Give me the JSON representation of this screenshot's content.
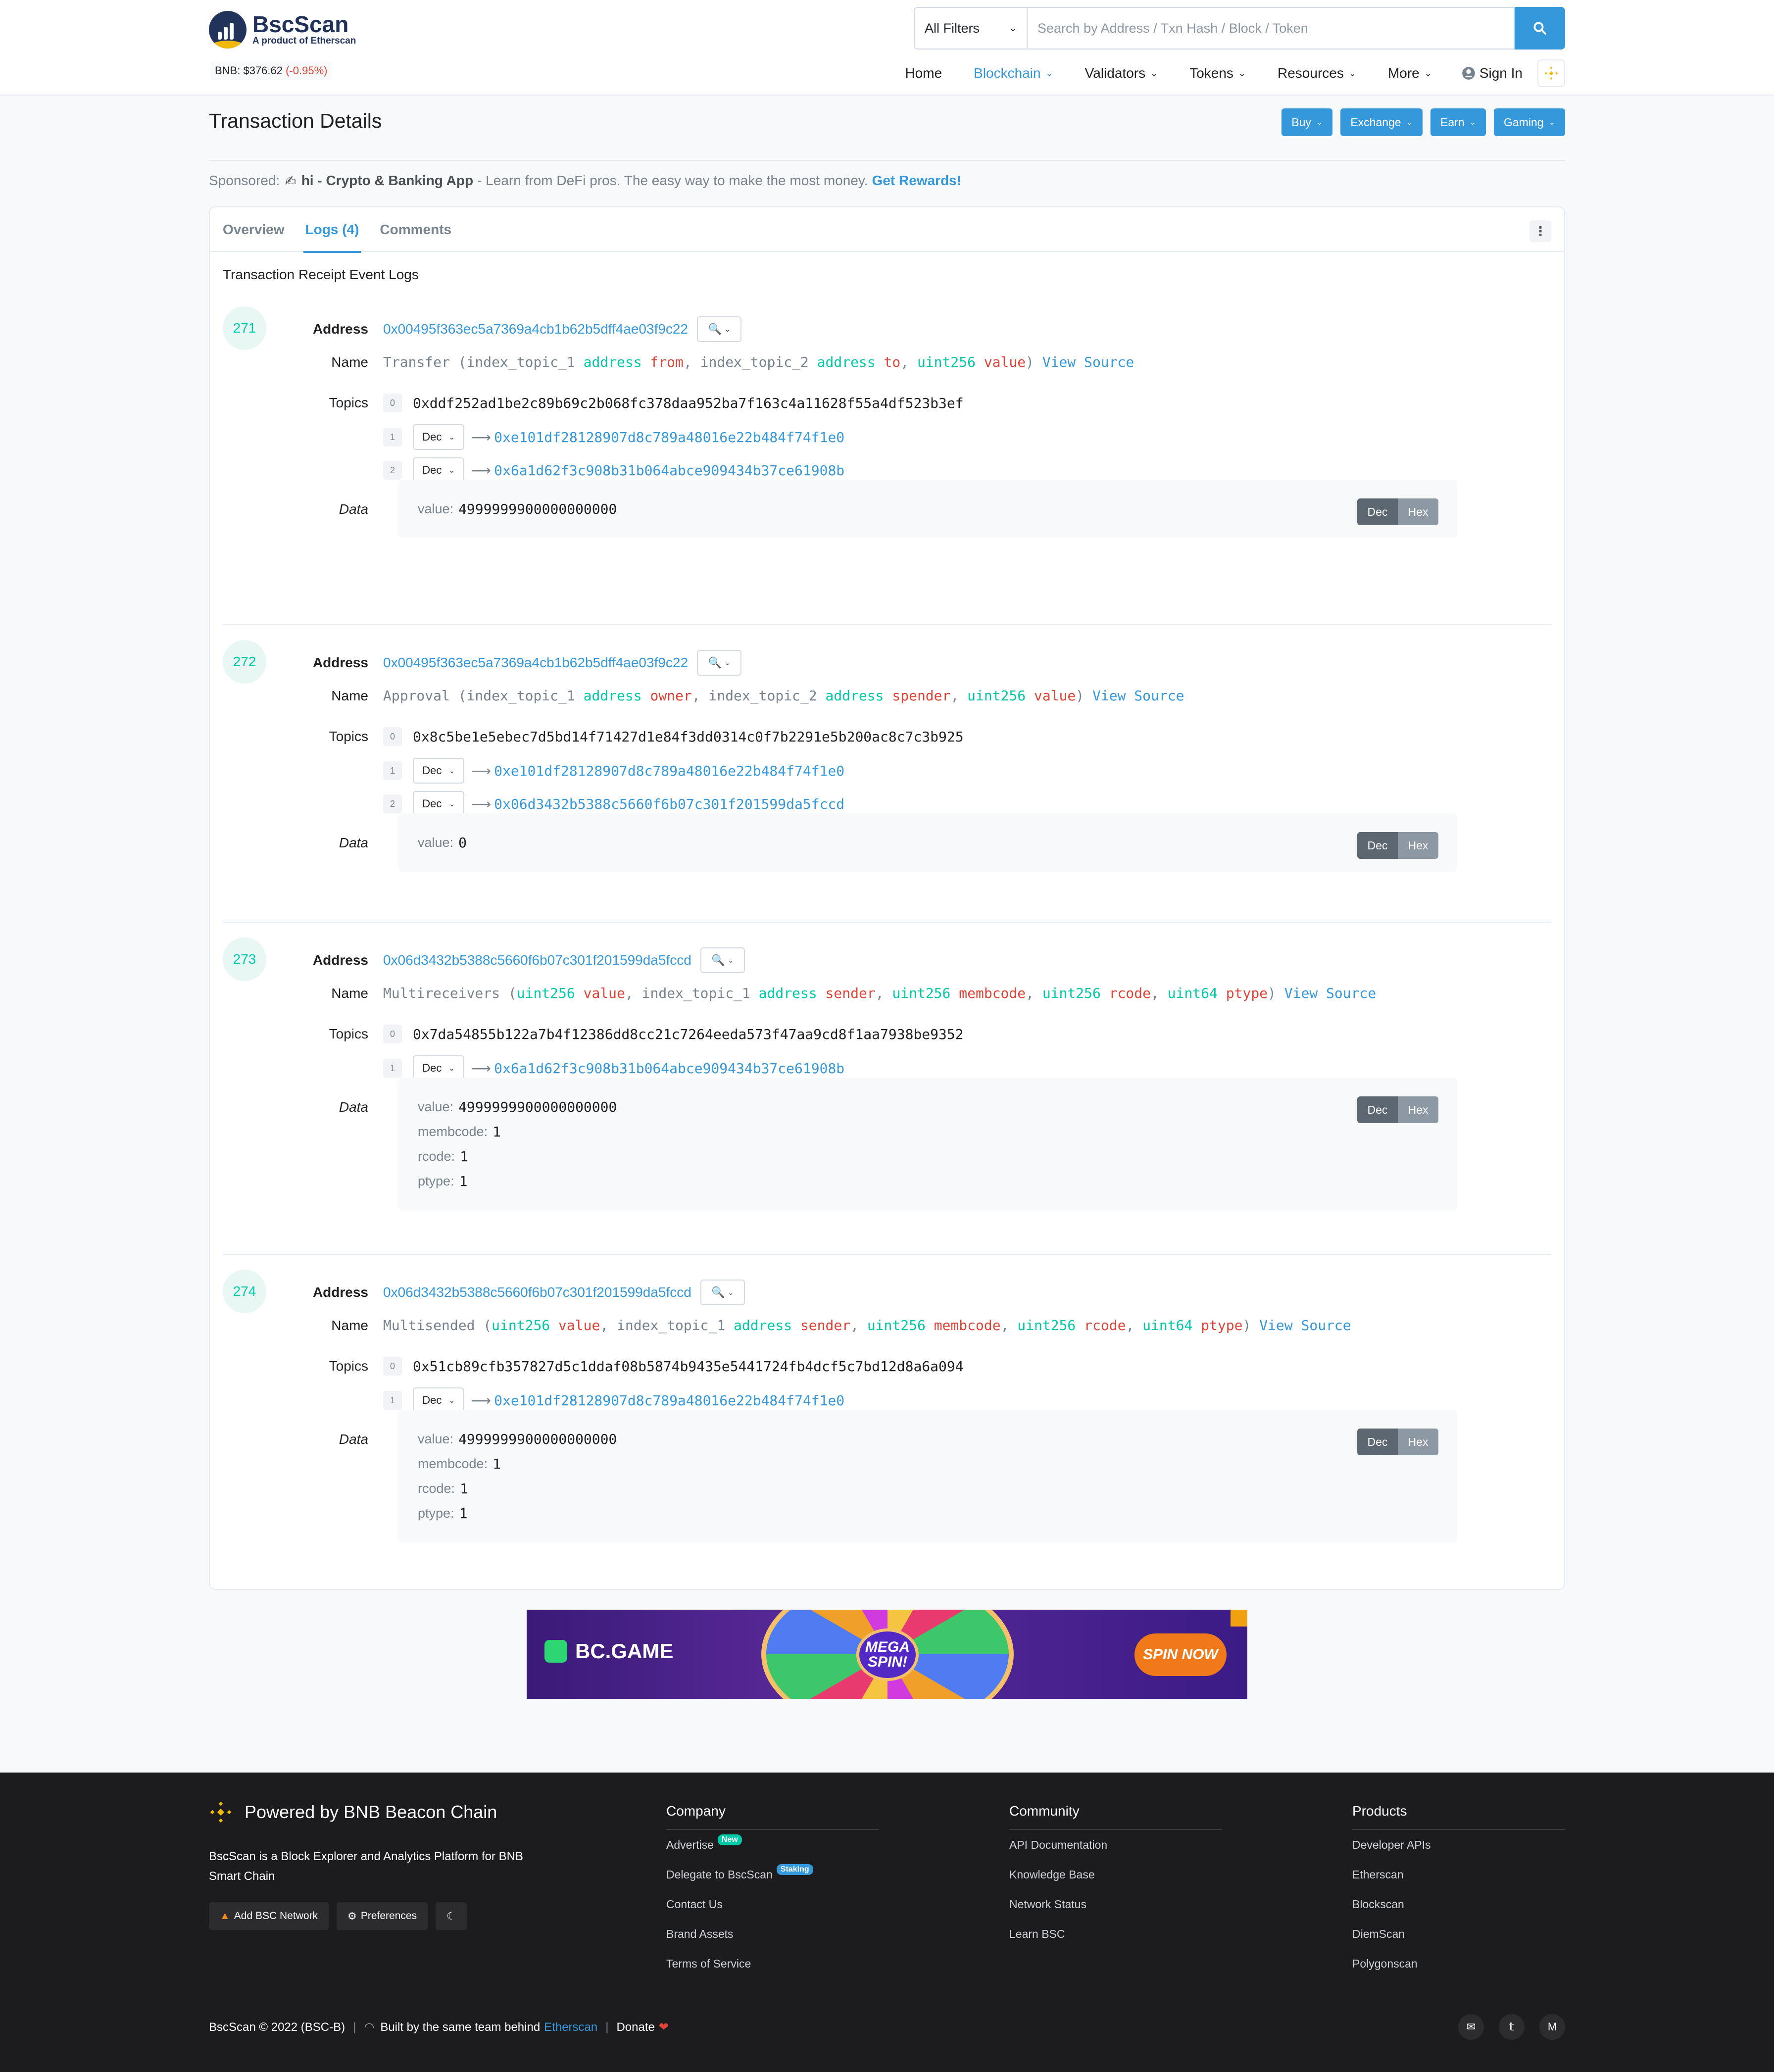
{
  "header": {
    "logo_name": "BscScan",
    "logo_sub": "A product of Etherscan",
    "price_label": "BNB: $376.62",
    "price_change": "(-0.95%)",
    "filter_label": "All Filters",
    "search_placeholder": "Search by Address / Txn Hash / Block / Token",
    "nav": [
      "Home",
      "Blockchain",
      "Validators",
      "Tokens",
      "Resources",
      "More"
    ],
    "sign_in": "Sign In"
  },
  "title": "Transaction Details",
  "pills": [
    "Buy",
    "Exchange",
    "Earn",
    "Gaming"
  ],
  "sponsored": {
    "label": "Sponsored:",
    "name": "hi - Crypto & Banking App",
    "text": "- Learn from DeFi pros. The easy way to make the most money.",
    "cta": "Get Rewards!"
  },
  "tabs": [
    "Overview",
    "Logs (4)",
    "Comments"
  ],
  "card_subtitle": "Transaction Receipt Event Logs",
  "labels": {
    "address": "Address",
    "name": "Name",
    "topics": "Topics",
    "data": "Data",
    "view_source": "View Source",
    "dec": "Dec",
    "hex": "Hex"
  },
  "logs": [
    {
      "index": "271",
      "address": "0x00495f363ec5a7369a4cb1b62b5dff4ae03f9c22",
      "event": "Transfer",
      "params": [
        {
          "pre": "index_topic_1",
          "type": "address",
          "name": "from"
        },
        {
          "pre": "index_topic_2",
          "type": "address",
          "name": "to"
        },
        {
          "pre": "",
          "type": "uint256",
          "name": "value"
        }
      ],
      "topic0": "0xddf252ad1be2c89b69c2b068fc378daa952ba7f163c4a11628f55a4df523b3ef",
      "topics": [
        "0xe101df28128907d8c789a48016e22b484f74f1e0",
        "0x6a1d62f3c908b31b064abce909434b37ce61908b"
      ],
      "data": [
        {
          "k": "value",
          "v": "4999999900000000000"
        }
      ]
    },
    {
      "index": "272",
      "address": "0x00495f363ec5a7369a4cb1b62b5dff4ae03f9c22",
      "event": "Approval",
      "params": [
        {
          "pre": "index_topic_1",
          "type": "address",
          "name": "owner"
        },
        {
          "pre": "index_topic_2",
          "type": "address",
          "name": "spender"
        },
        {
          "pre": "",
          "type": "uint256",
          "name": "value"
        }
      ],
      "topic0": "0x8c5be1e5ebec7d5bd14f71427d1e84f3dd0314c0f7b2291e5b200ac8c7c3b925",
      "topics": [
        "0xe101df28128907d8c789a48016e22b484f74f1e0",
        "0x06d3432b5388c5660f6b07c301f201599da5fccd"
      ],
      "data": [
        {
          "k": "value",
          "v": "0"
        }
      ]
    },
    {
      "index": "273",
      "address": "0x06d3432b5388c5660f6b07c301f201599da5fccd",
      "event": "Multireceivers",
      "params": [
        {
          "pre": "",
          "type": "uint256",
          "name": "value"
        },
        {
          "pre": "index_topic_1",
          "type": "address",
          "name": "sender"
        },
        {
          "pre": "",
          "type": "uint256",
          "name": "membcode"
        },
        {
          "pre": "",
          "type": "uint256",
          "name": "rcode"
        },
        {
          "pre": "",
          "type": "uint64",
          "name": "ptype"
        }
      ],
      "topic0": "0x7da54855b122a7b4f12386dd8cc21c7264eeda573f47aa9cd8f1aa7938be9352",
      "topics": [
        "0x6a1d62f3c908b31b064abce909434b37ce61908b"
      ],
      "data": [
        {
          "k": "value",
          "v": "4999999900000000000"
        },
        {
          "k": "membcode",
          "v": "1"
        },
        {
          "k": "rcode",
          "v": "1"
        },
        {
          "k": "ptype",
          "v": "1"
        }
      ]
    },
    {
      "index": "274",
      "address": "0x06d3432b5388c5660f6b07c301f201599da5fccd",
      "event": "Multisended",
      "params": [
        {
          "pre": "",
          "type": "uint256",
          "name": "value"
        },
        {
          "pre": "index_topic_1",
          "type": "address",
          "name": "sender"
        },
        {
          "pre": "",
          "type": "uint256",
          "name": "membcode"
        },
        {
          "pre": "",
          "type": "uint256",
          "name": "rcode"
        },
        {
          "pre": "",
          "type": "uint64",
          "name": "ptype"
        }
      ],
      "topic0": "0x51cb89cfb357827d5c1ddaf08b5874b9435e5441724fb4dcf5c7bd12d8a6a094",
      "topics": [
        "0xe101df28128907d8c789a48016e22b484f74f1e0"
      ],
      "data": [
        {
          "k": "value",
          "v": "4999999900000000000"
        },
        {
          "k": "membcode",
          "v": "1"
        },
        {
          "k": "rcode",
          "v": "1"
        },
        {
          "k": "ptype",
          "v": "1"
        }
      ]
    }
  ],
  "ad": {
    "brand": "BC.GAME",
    "wheel": "MEGA SPIN!",
    "cta": "SPIN NOW"
  },
  "footer": {
    "powered": "Powered by BNB Beacon Chain",
    "desc": "BscScan is a Block Explorer and Analytics Platform for BNB Smart Chain",
    "btn_add": "Add BSC Network",
    "btn_pref": "Preferences",
    "company_title": "Company",
    "company": [
      "Advertise",
      "Delegate to BscScan",
      "Contact Us",
      "Brand Assets",
      "Terms of Service"
    ],
    "badge_new": "New",
    "badge_staking": "Staking",
    "community_title": "Community",
    "community": [
      "API Documentation",
      "Knowledge Base",
      "Network Status",
      "Learn BSC"
    ],
    "products_title": "Products",
    "products": [
      "Developer APIs",
      "Etherscan",
      "Blockscan",
      "DiemScan",
      "Polygonscan"
    ],
    "copyright": "BscScan © 2022 (BSC-B)",
    "built": "Built by the same team behind",
    "etherscan": "Etherscan",
    "donate": "Donate"
  },
  "colors": {
    "accent": "#3498db",
    "type": "#00c9a7",
    "param": "#de4437",
    "footer_bg": "#1c1c1e"
  }
}
